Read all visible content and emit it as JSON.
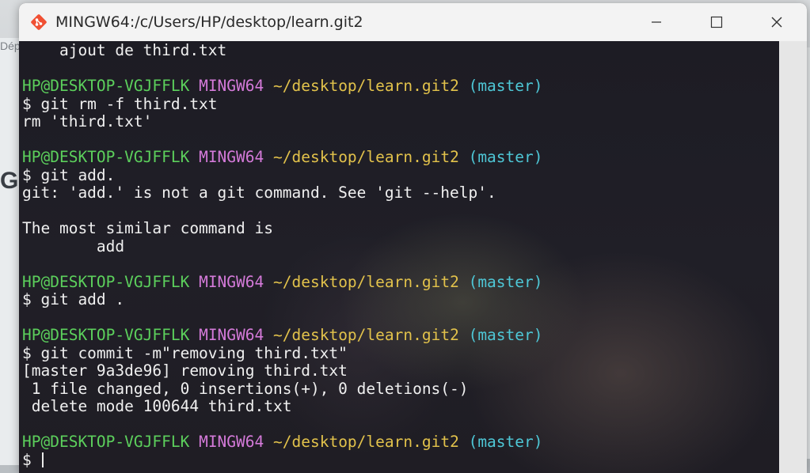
{
  "background": {
    "behind_text": "Dép",
    "behind_logo_text": "GC"
  },
  "window": {
    "title": "MINGW64:/c/Users/HP/desktop/learn.git2",
    "controls": {
      "minimize_icon": "minimize-icon",
      "maximize_icon": "maximize-icon",
      "close_icon": "close-icon"
    }
  },
  "colors": {
    "user": "#5cd05c",
    "system": "#d47ad9",
    "path": "#e2c24b",
    "branch": "#4ec7d6",
    "text": "#f0f0f0",
    "terminal_bg": "#1c1b22"
  },
  "prompt": {
    "user": "HP@DESKTOP-VGJFFLK",
    "system": "MINGW64",
    "path": "~/desktop/learn.git2",
    "branch": "(master)"
  },
  "terminal": {
    "lines": [
      {
        "type": "text",
        "text": "    ajout de third.txt"
      },
      {
        "type": "blank"
      },
      {
        "type": "prompt"
      },
      {
        "type": "text",
        "text": "$ git rm -f third.txt"
      },
      {
        "type": "text",
        "text": "rm 'third.txt'"
      },
      {
        "type": "blank"
      },
      {
        "type": "prompt"
      },
      {
        "type": "text",
        "text": "$ git add."
      },
      {
        "type": "text",
        "text": "git: 'add.' is not a git command. See 'git --help'."
      },
      {
        "type": "blank"
      },
      {
        "type": "text",
        "text": "The most similar command is"
      },
      {
        "type": "text",
        "text": "        add"
      },
      {
        "type": "blank"
      },
      {
        "type": "prompt"
      },
      {
        "type": "text",
        "text": "$ git add ."
      },
      {
        "type": "blank"
      },
      {
        "type": "prompt"
      },
      {
        "type": "text",
        "text": "$ git commit -m\"removing third.txt\""
      },
      {
        "type": "text",
        "text": "[master 9a3de96] removing third.txt"
      },
      {
        "type": "text",
        "text": " 1 file changed, 0 insertions(+), 0 deletions(-)"
      },
      {
        "type": "text",
        "text": " delete mode 100644 third.txt"
      },
      {
        "type": "blank"
      },
      {
        "type": "prompt"
      },
      {
        "type": "input",
        "text": "$ "
      }
    ]
  }
}
